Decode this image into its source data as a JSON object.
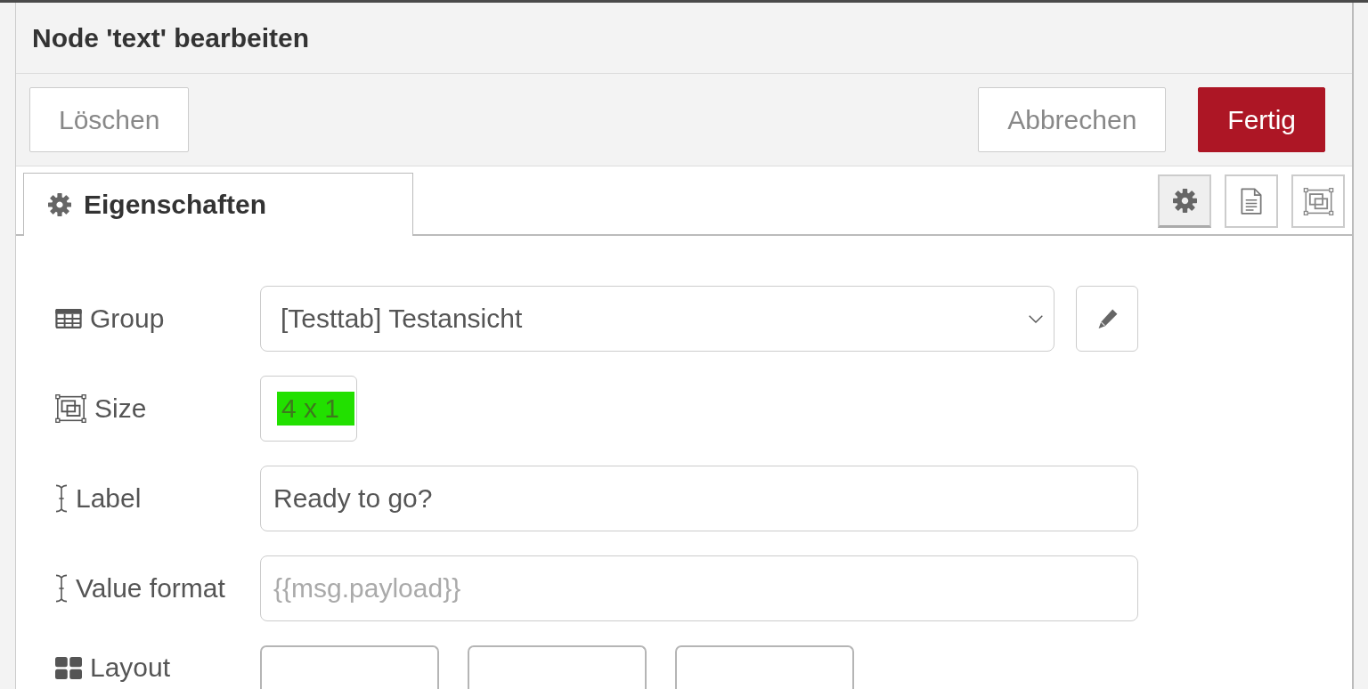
{
  "dialog": {
    "title": "Node 'text' bearbeiten"
  },
  "toolbar": {
    "left": [
      {
        "label": "Löschen",
        "kind": "secondary"
      }
    ],
    "right": [
      {
        "label": "Abbrechen",
        "kind": "secondary"
      },
      {
        "label": "Fertig",
        "kind": "primary"
      }
    ]
  },
  "tabs": [
    {
      "label": "Eigenschaften",
      "selected": true
    }
  ],
  "tab_buttons": [
    {
      "kind": "gear",
      "selected": true
    },
    {
      "kind": "document",
      "selected": false
    },
    {
      "kind": "frame",
      "selected": false
    }
  ],
  "form": [
    {
      "label": "Group",
      "kind": "select",
      "value": "[Testtab] Testansicht"
    },
    {
      "label": "Size",
      "kind": "size",
      "value": "4 x 1",
      "highlighted": true
    },
    {
      "label": "Label",
      "kind": "text",
      "value": "Ready to go?"
    },
    {
      "label": "Value format",
      "kind": "text",
      "placeholder": "{{msg.payload}}"
    },
    {
      "label": "Layout",
      "kind": "layout",
      "fields": [
        {
          "kind": "empty"
        },
        {
          "kind": "empty"
        },
        {
          "kind": "empty"
        }
      ]
    }
  ]
}
